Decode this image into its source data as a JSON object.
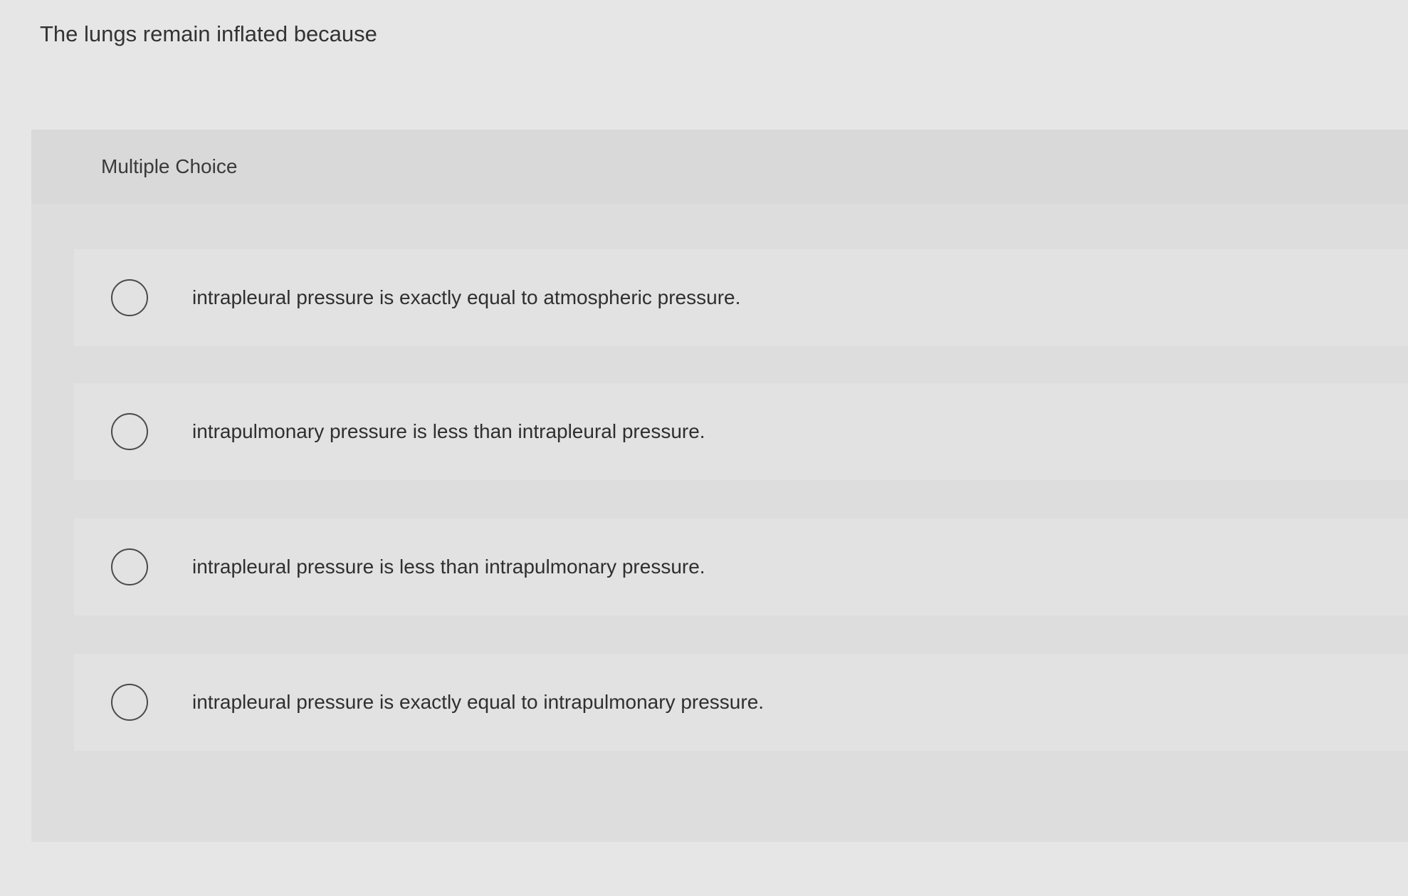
{
  "question": {
    "text": "The lungs remain inflated because"
  },
  "multiple_choice": {
    "label": "Multiple Choice",
    "options": [
      {
        "text": "intrapleural pressure is exactly equal to atmospheric pressure.",
        "selected": false
      },
      {
        "text": "intrapulmonary pressure is less than intrapleural pressure.",
        "selected": false
      },
      {
        "text": "intrapleural pressure is less than intrapulmonary pressure.",
        "selected": false
      },
      {
        "text": "intrapleural pressure is exactly equal to intrapulmonary pressure.",
        "selected": false
      }
    ]
  }
}
